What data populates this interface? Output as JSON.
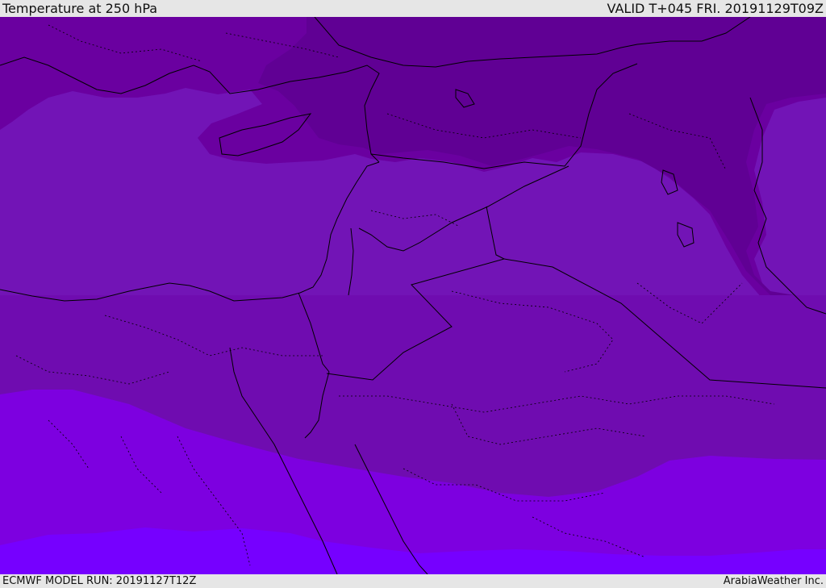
{
  "header": {
    "title": "Temperature at 250 hPa",
    "valid_time": "VALID T+045 FRI. 20191129T09Z"
  },
  "footer": {
    "model_run": "ECMWF MODEL RUN: 20191127T12Z",
    "credit": "ArabiaWeather Inc."
  },
  "map": {
    "colors": {
      "darkest": "#600094",
      "dark": "#6a00a0",
      "mid": "#7214b6",
      "mid_south": "#6f0cb0",
      "bright": "#7d00e0",
      "brightest": "#7600ff",
      "border": "#000000"
    }
  }
}
